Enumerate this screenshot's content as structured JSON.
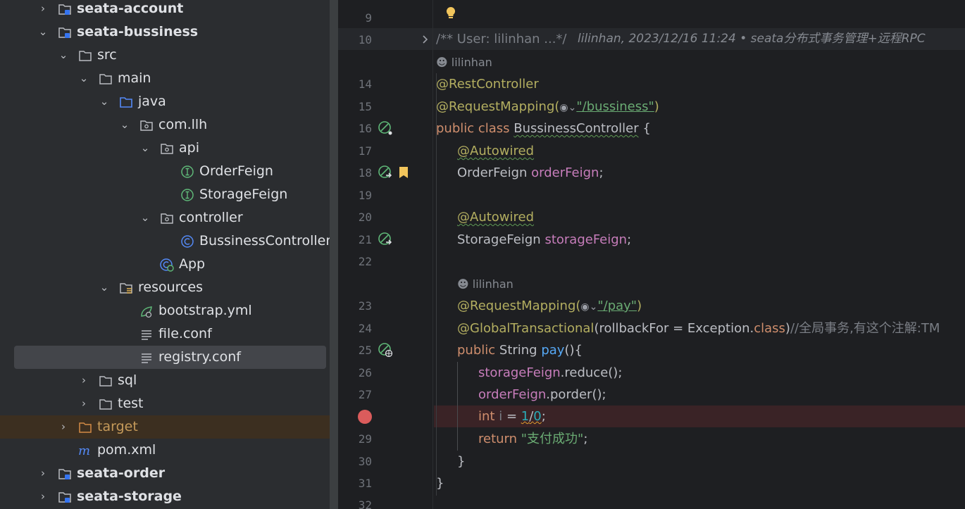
{
  "tree": [
    {
      "label": "seata-account",
      "arrow": "›",
      "icon": "module",
      "bold": true,
      "indent": 0
    },
    {
      "label": "seata-bussiness",
      "arrow": "⌄",
      "icon": "module",
      "bold": true,
      "indent": 0
    },
    {
      "label": "src",
      "arrow": "⌄",
      "icon": "folder",
      "indent": 1
    },
    {
      "label": "main",
      "arrow": "⌄",
      "icon": "folder",
      "indent": 2
    },
    {
      "label": "java",
      "arrow": "⌄",
      "icon": "source-folder",
      "indent": 3
    },
    {
      "label": "com.llh",
      "arrow": "⌄",
      "icon": "package",
      "indent": 4
    },
    {
      "label": "api",
      "arrow": "⌄",
      "icon": "package",
      "indent": 5
    },
    {
      "label": "OrderFeign",
      "arrow": "",
      "icon": "interface",
      "indent": 6
    },
    {
      "label": "StorageFeign",
      "arrow": "",
      "icon": "interface",
      "indent": 6
    },
    {
      "label": "controller",
      "arrow": "⌄",
      "icon": "package",
      "indent": 5
    },
    {
      "label": "BussinessController",
      "arrow": "",
      "icon": "class",
      "indent": 6
    },
    {
      "label": "App",
      "arrow": "",
      "icon": "spring-class",
      "indent": 5
    },
    {
      "label": "resources",
      "arrow": "⌄",
      "icon": "resources-folder",
      "indent": 3
    },
    {
      "label": "bootstrap.yml",
      "arrow": "",
      "icon": "yaml",
      "indent": 4
    },
    {
      "label": "file.conf",
      "arrow": "",
      "icon": "text-file",
      "indent": 4
    },
    {
      "label": "registry.conf",
      "arrow": "",
      "icon": "text-file",
      "indent": 4,
      "selected": true
    },
    {
      "label": "sql",
      "arrow": "›",
      "icon": "folder",
      "indent": 2
    },
    {
      "label": "test",
      "arrow": "›",
      "icon": "folder",
      "indent": 2
    },
    {
      "label": "target",
      "arrow": "›",
      "icon": "excluded-folder",
      "indent": 1,
      "excluded": true
    },
    {
      "label": "pom.xml",
      "arrow": "",
      "icon": "maven",
      "indent": 1
    },
    {
      "label": "seata-order",
      "arrow": "›",
      "icon": "module",
      "bold": true,
      "indent": 0
    },
    {
      "label": "seata-storage",
      "arrow": "›",
      "icon": "module",
      "bold": true,
      "indent": 0
    }
  ],
  "editor": {
    "line_numbers": [
      "9",
      "10",
      "14",
      "15",
      "16",
      "17",
      "18",
      "19",
      "20",
      "21",
      "22",
      "23",
      "24",
      "25",
      "26",
      "27",
      "29",
      "30",
      "31",
      "32"
    ],
    "fold_text": "/** User: lilinhan ...*/",
    "blame": "lilinhan, 2023/12/16 11:24 • seata分布式事务管理+远程RPC",
    "author_hint_1": "lilinhan",
    "author_hint_2": "lilinhan",
    "code": {
      "ann_restcontroller": "@RestController",
      "ann_requestmapping": "@RequestMapping(",
      "path_bussiness": "\"/bussiness\"",
      "paren_close": ")",
      "kw_public_class": "public class ",
      "class_name": "BussinessController",
      "brace_open": " {",
      "ann_autowired_1": "@Autowired",
      "type_orderfeign": "OrderFeign ",
      "field_orderfeign": "orderFeign",
      "semicolon": ";",
      "ann_autowired_2": "@Autowired",
      "type_storagefeign": "StorageFeign ",
      "field_storagefeign": "storageFeign",
      "ann_requestmapping_2": "@RequestMapping(",
      "path_pay": "\"/pay\"",
      "ann_global": "@GlobalTransactional",
      "global_args_open": "(rollbackFor = Exception.",
      "kw_class": "class",
      "global_args_close": ")",
      "global_comment": "//全局事务,有这个注解:TM",
      "kw_public": "public ",
      "type_string": "String ",
      "method_pay": "pay",
      "method_parens": "(){",
      "call_reduce_field": "storageFeign",
      "call_reduce_method": ".reduce",
      "call_parens": "();",
      "call_porder_field": "orderFeign",
      "call_porder_method": ".porder",
      "kw_int": "int ",
      "var_i": "i",
      "assign": " = ",
      "num_1": "1",
      "slash": "/",
      "num_0": "0",
      "kw_return": "return ",
      "return_str": "\"支付成功\"",
      "close_method": "}",
      "close_class": "}"
    }
  },
  "colors": {
    "tree_bg": "#2b2d30",
    "editor_bg": "#1e1f22",
    "selected_row": "#43454a",
    "breakpoint_line": "#3a2326",
    "breakpoint": "#db5c5c",
    "keyword": "#cf8e6d",
    "annotation": "#b3ae60",
    "string": "#6aab73",
    "field": "#c77dbb",
    "method": "#56a8f5",
    "number": "#2aacb8"
  }
}
